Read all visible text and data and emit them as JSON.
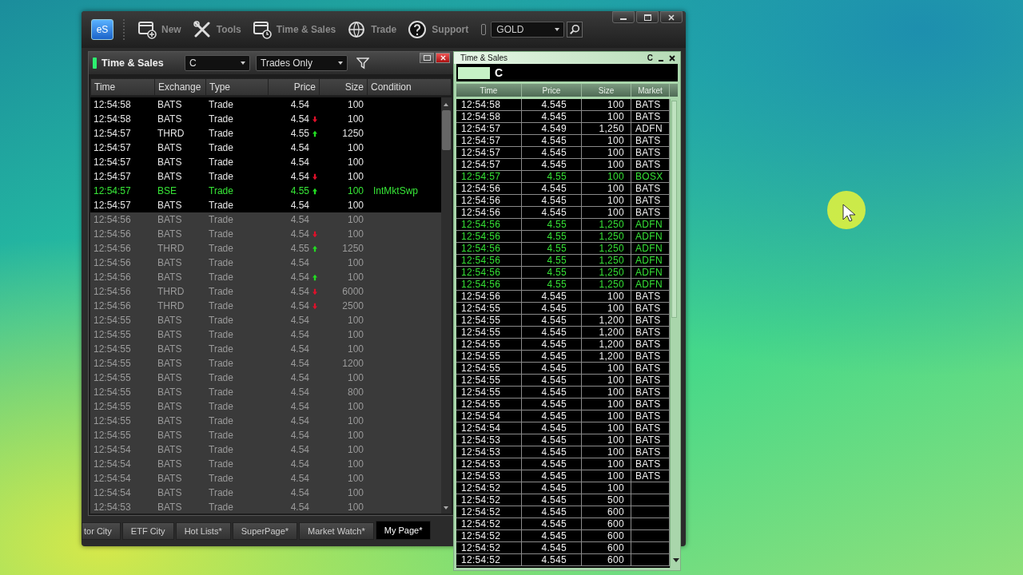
{
  "toolbar": {
    "logo": "eS",
    "items": [
      {
        "label": "New"
      },
      {
        "label": "Tools"
      },
      {
        "label": "Time & Sales"
      },
      {
        "label": "Trade"
      },
      {
        "label": "Support"
      }
    ],
    "symbol": "GOLD"
  },
  "panel": {
    "title": "Time & Sales",
    "symbol": "C",
    "filter": "Trades Only",
    "columns": [
      "Time",
      "Exchange",
      "Type",
      "Price",
      "Size",
      "Condition"
    ],
    "rows": [
      {
        "time": "12:54:58",
        "exchange": "BATS",
        "type": "Trade",
        "price": "4.54",
        "size": "100",
        "recent": true,
        "highlighted": false
      },
      {
        "time": "12:54:58",
        "exchange": "BATS",
        "type": "Trade",
        "price": "4.54",
        "kind": "down",
        "size": "100",
        "recent": true,
        "highlighted": false
      },
      {
        "time": "12:54:57",
        "exchange": "THRD",
        "type": "Trade",
        "price": "4.55",
        "kind": "up",
        "size": "1250",
        "recent": true,
        "highlighted": false
      },
      {
        "time": "12:54:57",
        "exchange": "BATS",
        "type": "Trade",
        "price": "4.54",
        "size": "100",
        "recent": true,
        "highlighted": false
      },
      {
        "time": "12:54:57",
        "exchange": "BATS",
        "type": "Trade",
        "price": "4.54",
        "size": "100",
        "recent": true,
        "highlighted": false
      },
      {
        "time": "12:54:57",
        "exchange": "BATS",
        "type": "Trade",
        "price": "4.54",
        "kind": "down",
        "size": "100",
        "recent": true,
        "highlighted": false
      },
      {
        "time": "12:54:57",
        "exchange": "BSE",
        "type": "Trade",
        "price": "4.55",
        "kind": "up",
        "size": "100",
        "condition": "IntMktSwp",
        "recent": true,
        "highlighted": true
      },
      {
        "time": "12:54:57",
        "exchange": "BATS",
        "type": "Trade",
        "price": "4.54",
        "size": "100",
        "recent": true,
        "highlighted": false
      },
      {
        "time": "12:54:56",
        "exchange": "BATS",
        "type": "Trade",
        "price": "4.54",
        "size": "100",
        "recent": false,
        "highlighted": false
      },
      {
        "time": "12:54:56",
        "exchange": "BATS",
        "type": "Trade",
        "price": "4.54",
        "kind": "down",
        "size": "100",
        "recent": false,
        "highlighted": false
      },
      {
        "time": "12:54:56",
        "exchange": "THRD",
        "type": "Trade",
        "price": "4.55",
        "kind": "up",
        "size": "1250",
        "recent": false,
        "highlighted": false
      },
      {
        "time": "12:54:56",
        "exchange": "BATS",
        "type": "Trade",
        "price": "4.54",
        "size": "100",
        "recent": false,
        "highlighted": false
      },
      {
        "time": "12:54:56",
        "exchange": "BATS",
        "type": "Trade",
        "price": "4.54",
        "kind": "up",
        "size": "100",
        "recent": false,
        "highlighted": false
      },
      {
        "time": "12:54:56",
        "exchange": "THRD",
        "type": "Trade",
        "price": "4.54",
        "kind": "down",
        "size": "6000",
        "recent": false,
        "highlighted": false
      },
      {
        "time": "12:54:56",
        "exchange": "THRD",
        "type": "Trade",
        "price": "4.54",
        "kind": "down",
        "size": "2500",
        "recent": false,
        "highlighted": false
      },
      {
        "time": "12:54:55",
        "exchange": "BATS",
        "type": "Trade",
        "price": "4.54",
        "size": "100",
        "recent": false,
        "highlighted": false
      },
      {
        "time": "12:54:55",
        "exchange": "BATS",
        "type": "Trade",
        "price": "4.54",
        "size": "100",
        "recent": false,
        "highlighted": false
      },
      {
        "time": "12:54:55",
        "exchange": "BATS",
        "type": "Trade",
        "price": "4.54",
        "size": "100",
        "recent": false,
        "highlighted": false
      },
      {
        "time": "12:54:55",
        "exchange": "BATS",
        "type": "Trade",
        "price": "4.54",
        "size": "1200",
        "recent": false,
        "highlighted": false
      },
      {
        "time": "12:54:55",
        "exchange": "BATS",
        "type": "Trade",
        "price": "4.54",
        "size": "100",
        "recent": false,
        "highlighted": false
      },
      {
        "time": "12:54:55",
        "exchange": "BATS",
        "type": "Trade",
        "price": "4.54",
        "size": "800",
        "recent": false,
        "highlighted": false
      },
      {
        "time": "12:54:55",
        "exchange": "BATS",
        "type": "Trade",
        "price": "4.54",
        "size": "100",
        "recent": false,
        "highlighted": false
      },
      {
        "time": "12:54:55",
        "exchange": "BATS",
        "type": "Trade",
        "price": "4.54",
        "size": "100",
        "recent": false,
        "highlighted": false
      },
      {
        "time": "12:54:55",
        "exchange": "BATS",
        "type": "Trade",
        "price": "4.54",
        "size": "100",
        "recent": false,
        "highlighted": false
      },
      {
        "time": "12:54:54",
        "exchange": "BATS",
        "type": "Trade",
        "price": "4.54",
        "size": "100",
        "recent": false,
        "highlighted": false
      },
      {
        "time": "12:54:54",
        "exchange": "BATS",
        "type": "Trade",
        "price": "4.54",
        "size": "100",
        "recent": false,
        "highlighted": false
      },
      {
        "time": "12:54:54",
        "exchange": "BATS",
        "type": "Trade",
        "price": "4.54",
        "size": "100",
        "recent": false,
        "highlighted": false
      },
      {
        "time": "12:54:54",
        "exchange": "BATS",
        "type": "Trade",
        "price": "4.54",
        "size": "100",
        "recent": false,
        "highlighted": false
      },
      {
        "time": "12:54:53",
        "exchange": "BATS",
        "type": "Trade",
        "price": "4.54",
        "size": "100",
        "recent": false,
        "highlighted": false
      }
    ]
  },
  "tabs": [
    {
      "label": "tor City",
      "selected": false
    },
    {
      "label": "ETF City",
      "selected": false
    },
    {
      "label": "Hot Lists*",
      "selected": false
    },
    {
      "label": "SuperPage*",
      "selected": false
    },
    {
      "label": "Market Watch*",
      "selected": false
    },
    {
      "label": "My Page*",
      "selected": true
    }
  ],
  "side_window": {
    "title": "Time & Sales",
    "code_button": "C",
    "symbol": "C",
    "columns": [
      "Time",
      "Price",
      "Size",
      "Market"
    ],
    "rows": [
      {
        "time": "12:54:58",
        "price": "4.545",
        "size": "100",
        "market": "BATS",
        "highlighted": false
      },
      {
        "time": "12:54:58",
        "price": "4.545",
        "size": "100",
        "market": "BATS",
        "highlighted": false
      },
      {
        "time": "12:54:57",
        "price": "4.549",
        "size": "1,250",
        "market": "ADFN",
        "highlighted": false
      },
      {
        "time": "12:54:57",
        "price": "4.545",
        "size": "100",
        "market": "BATS",
        "highlighted": false
      },
      {
        "time": "12:54:57",
        "price": "4.545",
        "size": "100",
        "market": "BATS",
        "highlighted": false
      },
      {
        "time": "12:54:57",
        "price": "4.545",
        "size": "100",
        "market": "BATS",
        "highlighted": false
      },
      {
        "time": "12:54:57",
        "price": "4.55",
        "size": "100",
        "market": "BOSX",
        "highlighted": true
      },
      {
        "time": "12:54:56",
        "price": "4.545",
        "size": "100",
        "market": "BATS",
        "highlighted": false
      },
      {
        "time": "12:54:56",
        "price": "4.545",
        "size": "100",
        "market": "BATS",
        "highlighted": false
      },
      {
        "time": "12:54:56",
        "price": "4.545",
        "size": "100",
        "market": "BATS",
        "highlighted": false
      },
      {
        "time": "12:54:56",
        "price": "4.55",
        "size": "1,250",
        "market": "ADFN",
        "highlighted": true
      },
      {
        "time": "12:54:56",
        "price": "4.55",
        "size": "1,250",
        "market": "ADFN",
        "highlighted": true
      },
      {
        "time": "12:54:56",
        "price": "4.55",
        "size": "1,250",
        "market": "ADFN",
        "highlighted": true
      },
      {
        "time": "12:54:56",
        "price": "4.55",
        "size": "1,250",
        "market": "ADFN",
        "highlighted": true
      },
      {
        "time": "12:54:56",
        "price": "4.55",
        "size": "1,250",
        "market": "ADFN",
        "highlighted": true
      },
      {
        "time": "12:54:56",
        "price": "4.55",
        "size": "1,250",
        "market": "ADFN",
        "highlighted": true
      },
      {
        "time": "12:54:56",
        "price": "4.545",
        "size": "100",
        "market": "BATS",
        "highlighted": false
      },
      {
        "time": "12:54:55",
        "price": "4.545",
        "size": "100",
        "market": "BATS",
        "highlighted": false
      },
      {
        "time": "12:54:55",
        "price": "4.545",
        "size": "1,200",
        "market": "BATS",
        "highlighted": false
      },
      {
        "time": "12:54:55",
        "price": "4.545",
        "size": "1,200",
        "market": "BATS",
        "highlighted": false
      },
      {
        "time": "12:54:55",
        "price": "4.545",
        "size": "1,200",
        "market": "BATS",
        "highlighted": false
      },
      {
        "time": "12:54:55",
        "price": "4.545",
        "size": "1,200",
        "market": "BATS",
        "highlighted": false
      },
      {
        "time": "12:54:55",
        "price": "4.545",
        "size": "100",
        "market": "BATS",
        "highlighted": false
      },
      {
        "time": "12:54:55",
        "price": "4.545",
        "size": "100",
        "market": "BATS",
        "highlighted": false
      },
      {
        "time": "12:54:55",
        "price": "4.545",
        "size": "100",
        "market": "BATS",
        "highlighted": false
      },
      {
        "time": "12:54:55",
        "price": "4.545",
        "size": "100",
        "market": "BATS",
        "highlighted": false
      },
      {
        "time": "12:54:54",
        "price": "4.545",
        "size": "100",
        "market": "BATS",
        "highlighted": false
      },
      {
        "time": "12:54:54",
        "price": "4.545",
        "size": "100",
        "market": "BATS",
        "highlighted": false
      },
      {
        "time": "12:54:53",
        "price": "4.545",
        "size": "100",
        "market": "BATS",
        "highlighted": false
      },
      {
        "time": "12:54:53",
        "price": "4.545",
        "size": "100",
        "market": "BATS",
        "highlighted": false
      },
      {
        "time": "12:54:53",
        "price": "4.545",
        "size": "100",
        "market": "BATS",
        "highlighted": false
      },
      {
        "time": "12:54:53",
        "price": "4.545",
        "size": "100",
        "market": "BATS",
        "highlighted": false
      },
      {
        "time": "12:54:52",
        "price": "4.545",
        "size": "100",
        "highlighted": false
      },
      {
        "time": "12:54:52",
        "price": "4.545",
        "size": "500",
        "highlighted": false
      },
      {
        "time": "12:54:52",
        "price": "4.545",
        "size": "600",
        "highlighted": false
      },
      {
        "time": "12:54:52",
        "price": "4.545",
        "size": "600",
        "highlighted": false
      },
      {
        "time": "12:54:52",
        "price": "4.545",
        "size": "600",
        "highlighted": false
      },
      {
        "time": "12:54:52",
        "price": "4.545",
        "size": "600",
        "highlighted": false
      },
      {
        "time": "12:54:52",
        "price": "4.545",
        "size": "600",
        "highlighted": false
      }
    ]
  }
}
